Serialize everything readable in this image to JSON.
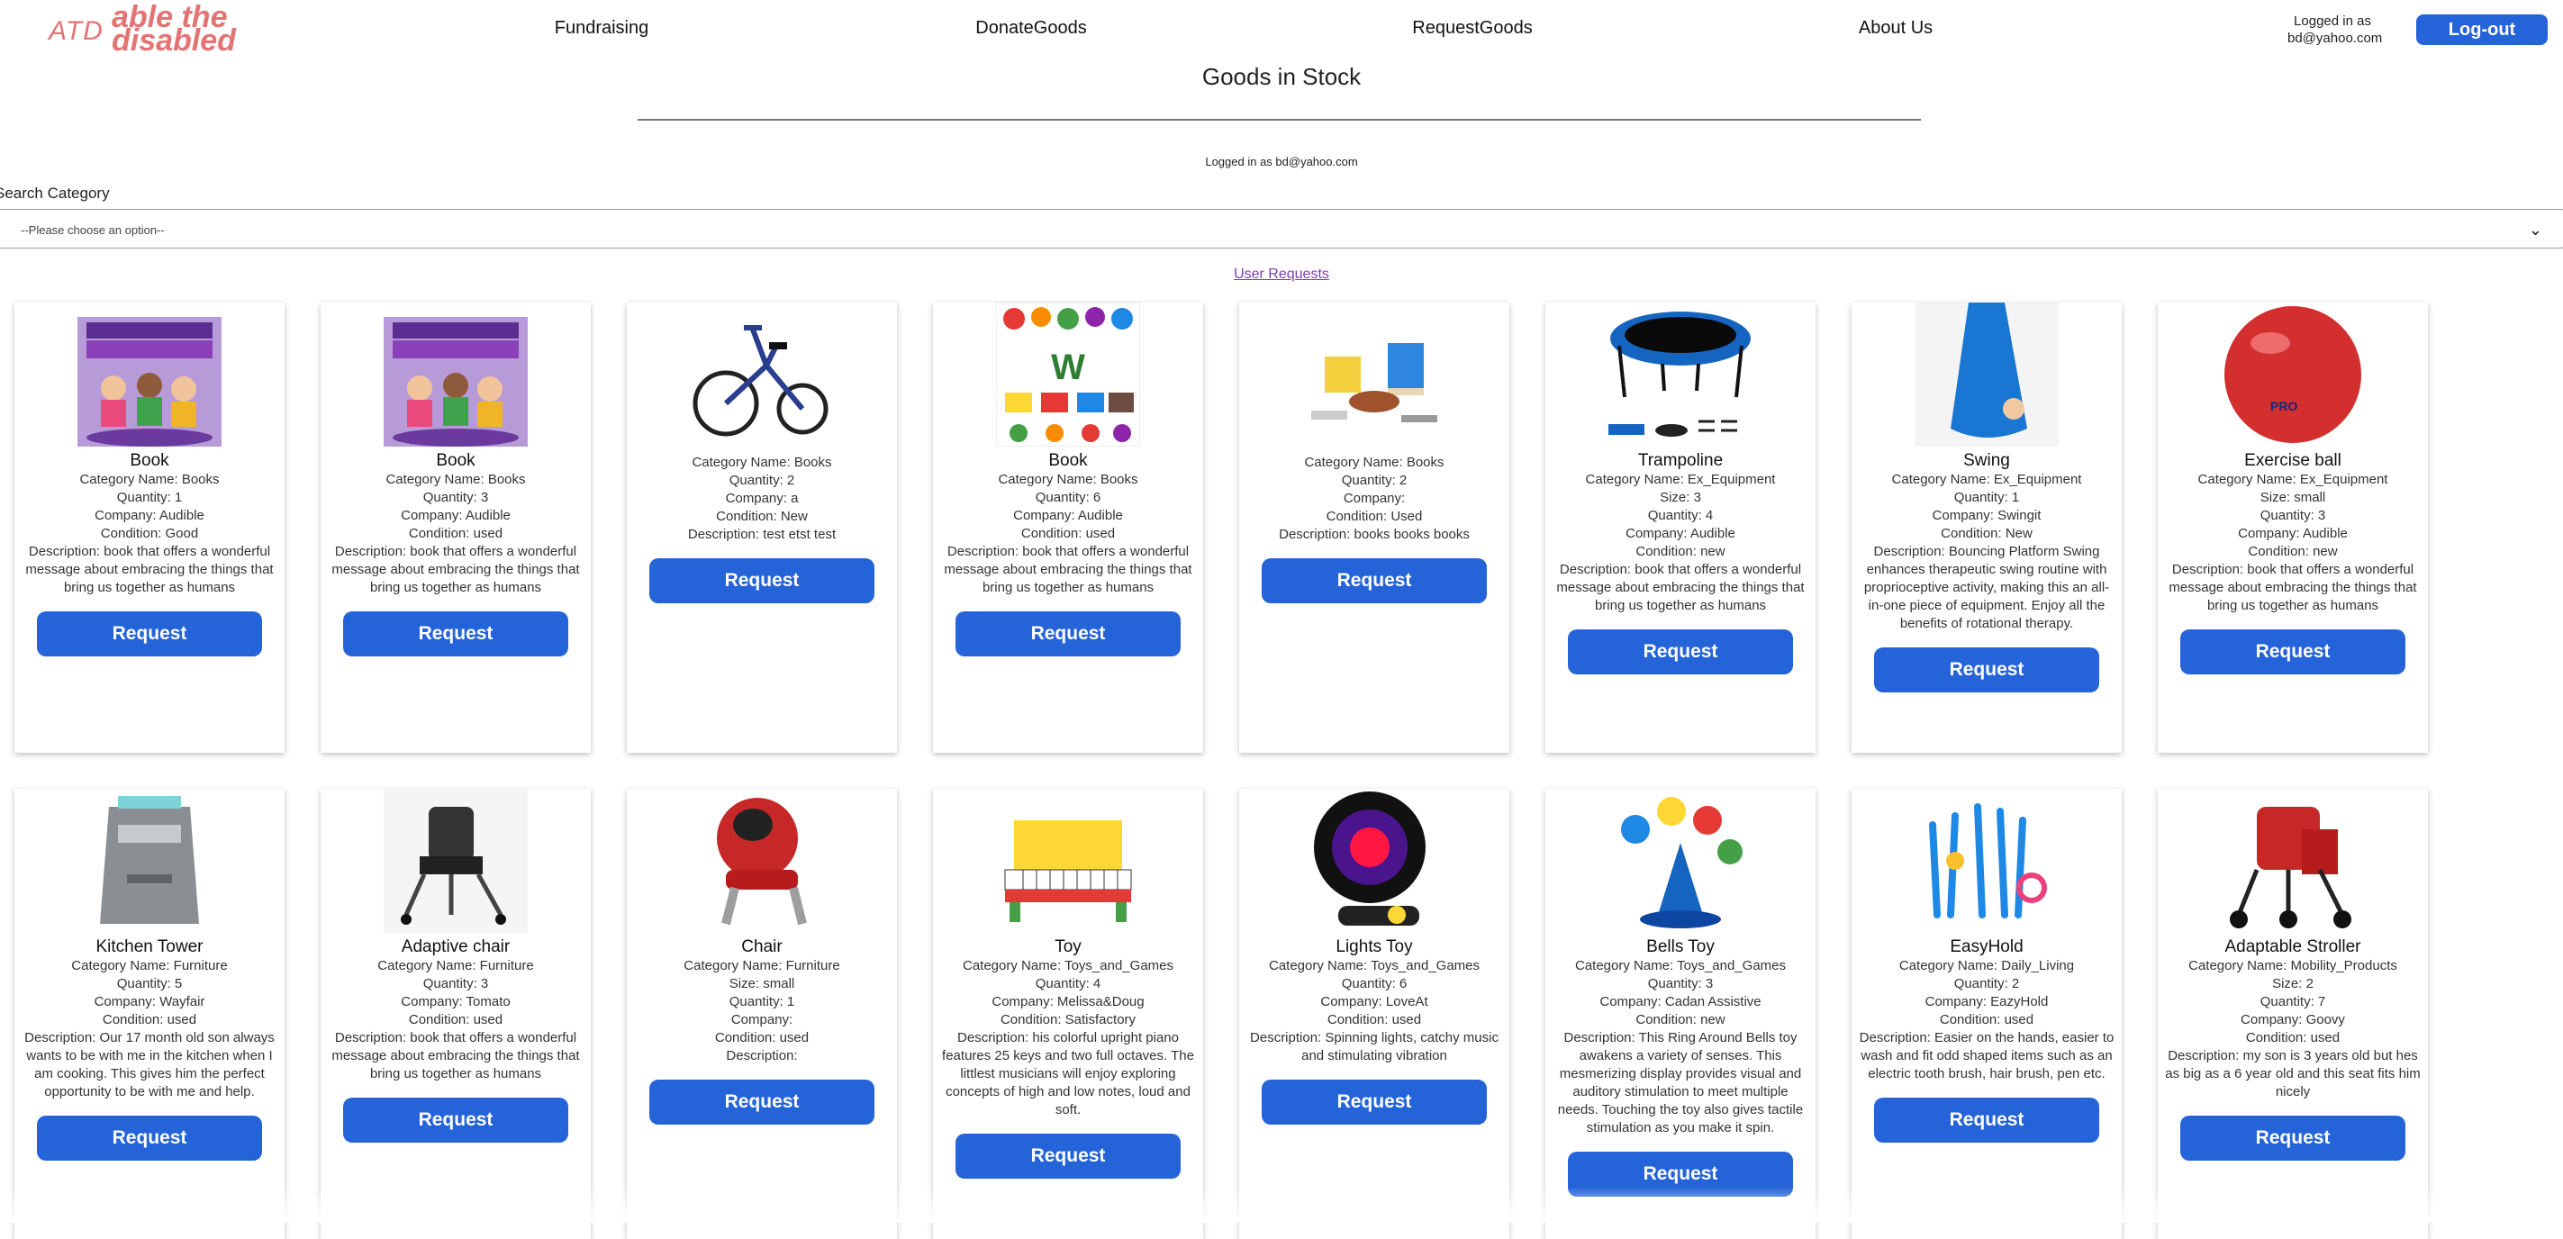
{
  "logo": {
    "abbr": "ATD",
    "brand": "able the disabled"
  },
  "nav": [
    {
      "label": "Fundraising"
    },
    {
      "label": "DonateGoods"
    },
    {
      "label": "RequestGoods"
    },
    {
      "label": "About Us"
    }
  ],
  "session": {
    "logged_in_label": "Logged in as",
    "email": "bd@yahoo.com",
    "logged_in_full": "Logged in as bd@yahoo.com",
    "logout_label": "Log-out"
  },
  "page_title": "Goods in Stock",
  "search": {
    "label": "Search Category",
    "placeholder": "--Please choose an option--"
  },
  "user_requests_link": "User Requests",
  "request_label": "Request",
  "cards": [
    {
      "image": "purple-people-book-image",
      "title": "Book",
      "lines": [
        "Category Name: Books",
        "Quantity: 1",
        "Company: Audible",
        "Condition: Good",
        "Description: book that offers a wonderful message about embracing the things that bring us together as humans"
      ]
    },
    {
      "image": "purple-people-book-image",
      "title": "Book",
      "lines": [
        "Category Name: Books",
        "Quantity: 3",
        "Company: Audible",
        "Condition: used",
        "Description: book that offers a wonderful message about embracing the things that bring us together as humans"
      ]
    },
    {
      "image": "tricycle-image",
      "title": "",
      "lines": [
        "Category Name: Books",
        "Quantity: 2",
        "Company: a",
        "Condition: New",
        "Description: test etst test"
      ]
    },
    {
      "image": "first-words-book-image",
      "title": "Book",
      "lines": [
        "Category Name: Books",
        "Quantity: 6",
        "Company: Audible",
        "Condition: used",
        "Description: book that offers a wonderful message about embracing the things that bring us together as humans"
      ]
    },
    {
      "image": "toy-chairs-image",
      "title": "",
      "lines": [
        "Category Name: Books",
        "Quantity: 2",
        "Company:",
        "Condition: Used",
        "Description: books books books"
      ]
    },
    {
      "image": "trampoline-image",
      "title": "Trampoline",
      "lines": [
        "Category Name: Ex_Equipment",
        "Size: 3",
        "Quantity: 4",
        "Company: Audible",
        "Condition: new",
        "Description: book that offers a wonderful message about embracing the things that bring us together as humans"
      ]
    },
    {
      "image": "swing-image",
      "title": "Swing",
      "lines": [
        "Category Name: Ex_Equipment",
        "Quantity: 1",
        "Company: Swingit",
        "Condition: New",
        "Description: Bouncing Platform Swing enhances therapeutic swing routine with proprioceptive activity, making this an all-in-one piece of equipment. Enjoy all the benefits of rotational therapy."
      ]
    },
    {
      "image": "exercise-ball-image",
      "title": "Exercise ball",
      "lines": [
        "Category Name: Ex_Equipment",
        "Size: small",
        "Quantity: 3",
        "Company: Audible",
        "Condition: new",
        "Description: book that offers a wonderful message about embracing the things that bring us together as humans"
      ]
    },
    {
      "image": "kitchen-tower-image",
      "title": "Kitchen Tower",
      "lines": [
        "Category Name: Furniture",
        "Quantity: 5",
        "Company: Wayfair",
        "Condition: used",
        "Description: Our 17 month old son always wants to be with me in the kitchen when I am cooking. This gives him the perfect opportunity to be with me and help."
      ]
    },
    {
      "image": "adaptive-chair-image",
      "title": "Adaptive chair",
      "lines": [
        "Category Name: Furniture",
        "Quantity: 3",
        "Company: Tomato",
        "Condition: used",
        "Description: book that offers a wonderful message about embracing the things that bring us together as humans"
      ]
    },
    {
      "image": "red-chair-image",
      "title": "Chair",
      "lines": [
        "Category Name: Furniture",
        "Size: small",
        "Quantity: 1",
        "Company:",
        "Condition: used",
        "Description:"
      ]
    },
    {
      "image": "toy-piano-image",
      "title": "Toy",
      "lines": [
        "Category Name: Toys_and_Games",
        "Quantity: 4",
        "Company: Melissa&Doug",
        "Condition: Satisfactory",
        "Description: his colorful upright piano features 25 keys and two full octaves. The littlest musicians will enjoy exploring concepts of high and low notes, loud and soft."
      ]
    },
    {
      "image": "lights-toy-image",
      "title": "Lights Toy",
      "lines": [
        "Category Name: Toys_and_Games",
        "Quantity: 6",
        "Company: LoveAt",
        "Condition: used",
        "Description: Spinning lights, catchy music and stimulating vibration"
      ]
    },
    {
      "image": "bells-toy-image",
      "title": "Bells Toy",
      "lines": [
        "Category Name: Toys_and_Games",
        "Quantity: 3",
        "Company: Cadan Assistive",
        "Condition: new",
        "Description: This Ring Around Bells toy awakens a variety of senses. This mesmerizing display provides visual and auditory stimulation to meet multiple needs. Touching the toy also gives tactile stimulation as you make it spin."
      ]
    },
    {
      "image": "easyhold-image",
      "title": "EasyHold",
      "lines": [
        "Category Name: Daily_Living",
        "Quantity: 2",
        "Company: EazyHold",
        "Condition: used",
        "Description: Easier on the hands, easier to wash and fit odd shaped items such as an electric tooth brush, hair brush, pen etc."
      ]
    },
    {
      "image": "stroller-image",
      "title": "Adaptable Stroller",
      "lines": [
        "Category Name: Mobility_Products",
        "Size: 2",
        "Quantity: 7",
        "Company: Goovy",
        "Condition: used",
        "Description: my son is 3 years old but hes as big as a 6 year old and this seat fits him nicely"
      ]
    }
  ]
}
